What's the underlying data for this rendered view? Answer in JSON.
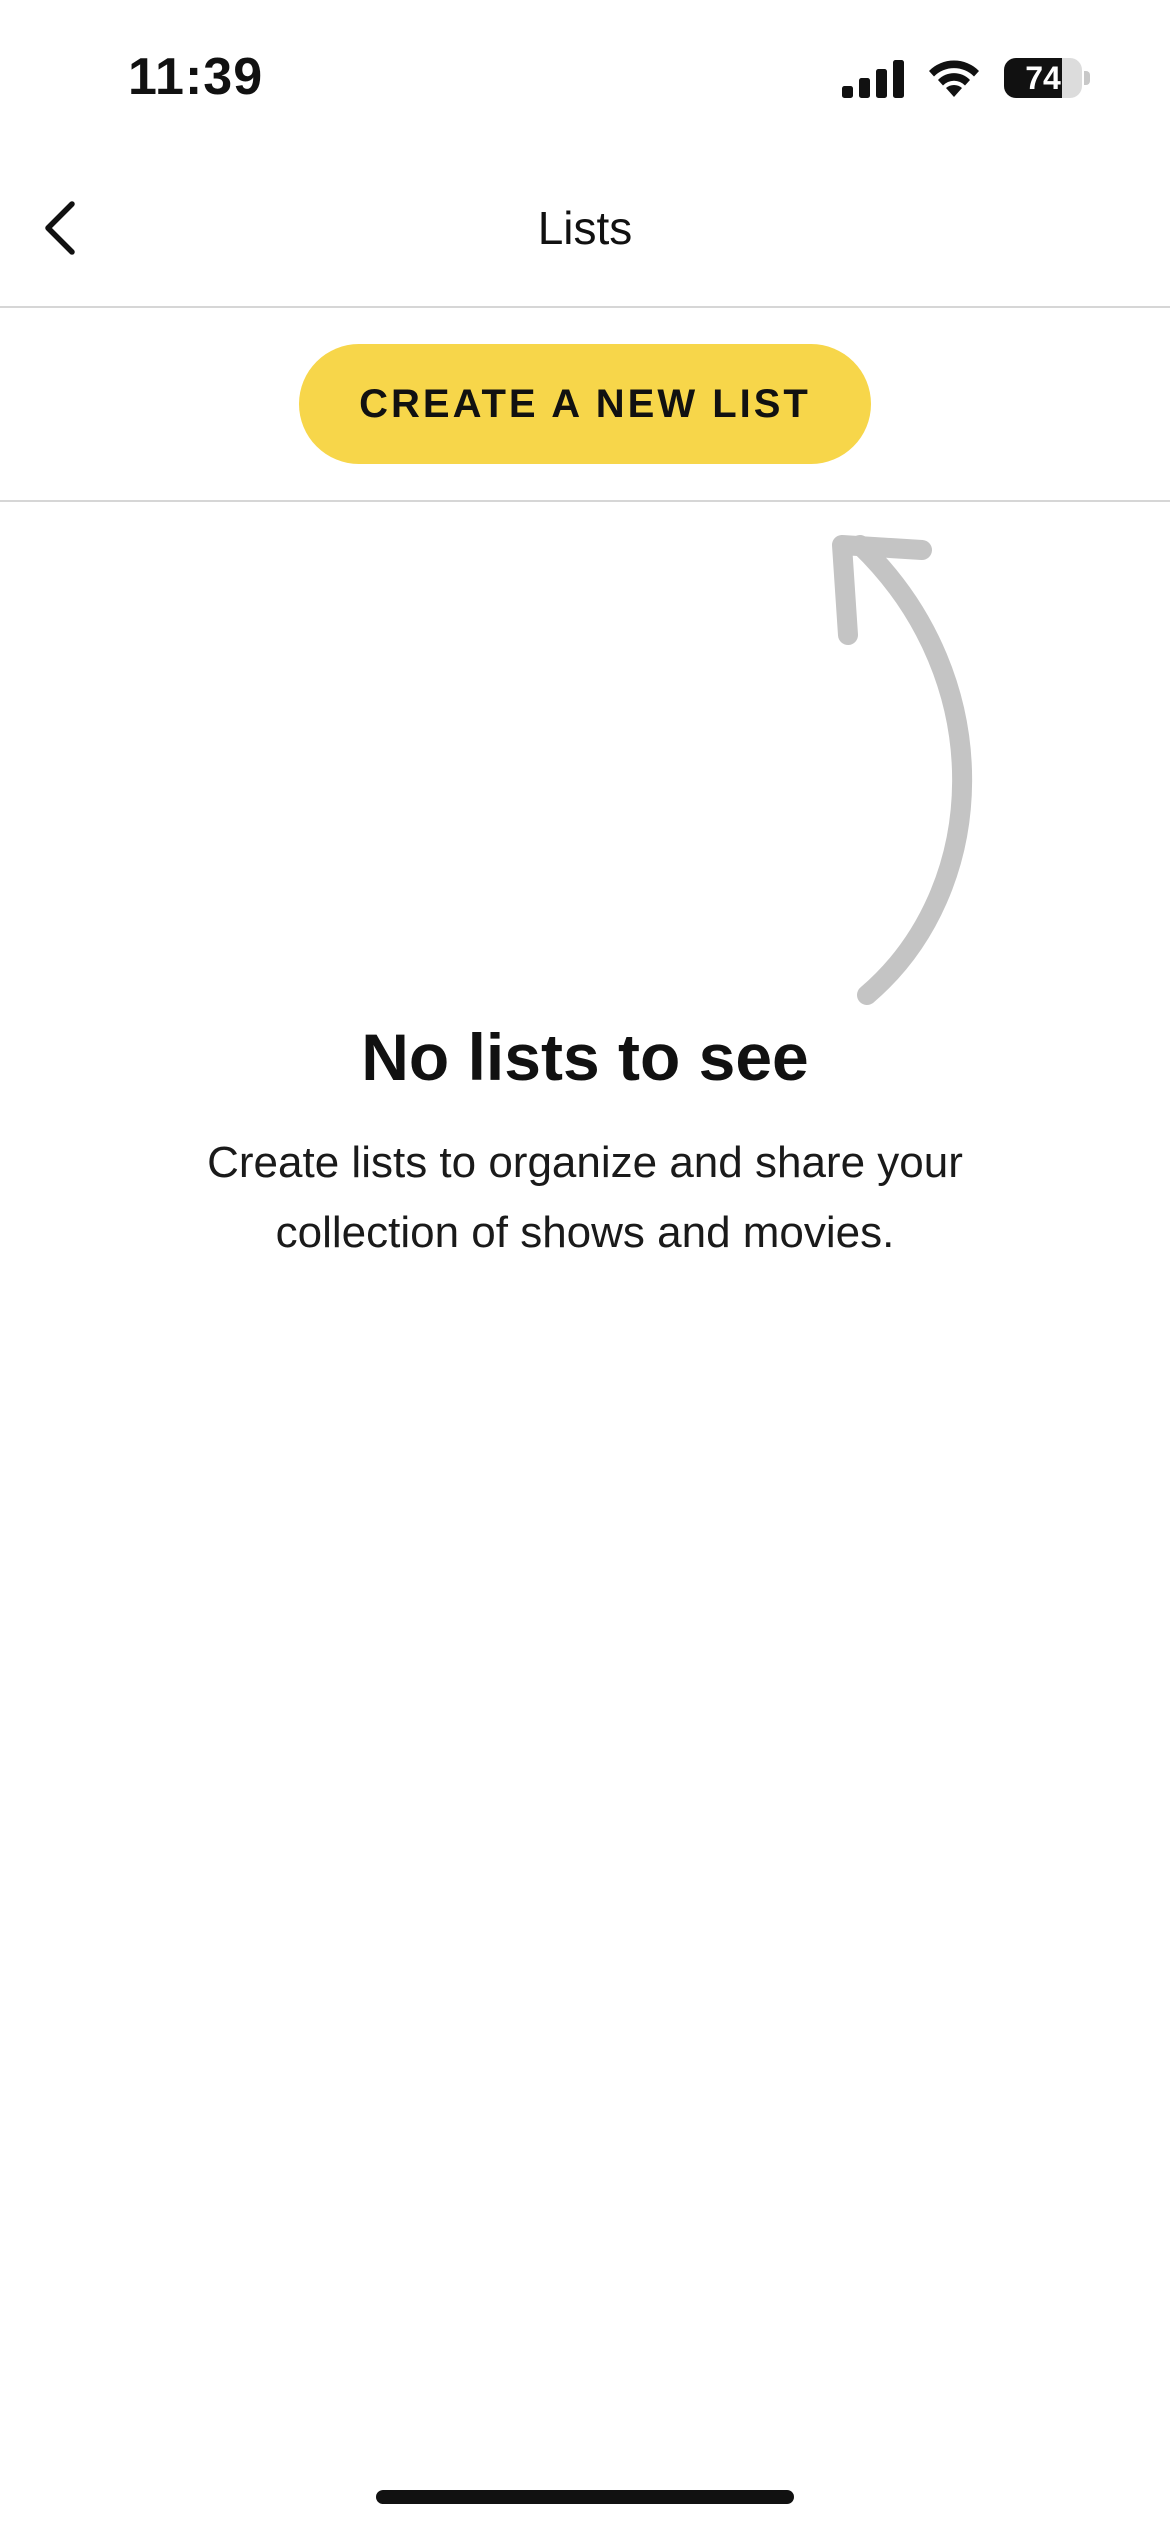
{
  "status_bar": {
    "time": "11:39",
    "battery_level": "74",
    "battery_percent": 74,
    "icons": [
      "cellular-signal-icon",
      "wifi-icon",
      "battery-icon"
    ]
  },
  "header": {
    "title": "Lists",
    "back_icon": "chevron-left-icon"
  },
  "create_button": {
    "label": "CREATE A NEW LIST",
    "color": "#f7d64a"
  },
  "empty_state": {
    "title": "No lists to see",
    "body": "Create lists to organize and share your collection of shows and movies.",
    "arrow_icon": "curved-arrow-up-icon",
    "arrow_color": "#c4c4c4"
  },
  "colors": {
    "background": "#ffffff",
    "divider": "#d6d6d6",
    "text": "#111111"
  }
}
